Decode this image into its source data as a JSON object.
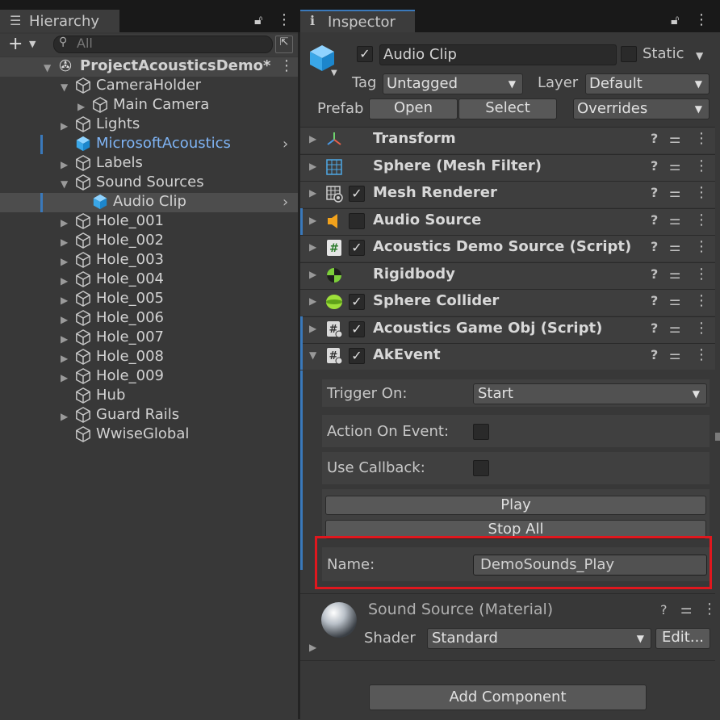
{
  "hierarchy": {
    "title": "Hierarchy",
    "search_placeholder": "All",
    "add_label": "+",
    "root": "ProjectAcousticsDemo*",
    "items": [
      {
        "label": "CameraHolder"
      },
      {
        "label": "Main Camera"
      },
      {
        "label": "Lights"
      },
      {
        "label": "MicrosoftAcoustics"
      },
      {
        "label": "Labels"
      },
      {
        "label": "Sound Sources"
      },
      {
        "label": "Audio Clip"
      },
      {
        "label": "Hole_001"
      },
      {
        "label": "Hole_002"
      },
      {
        "label": "Hole_003"
      },
      {
        "label": "Hole_004"
      },
      {
        "label": "Hole_005"
      },
      {
        "label": "Hole_006"
      },
      {
        "label": "Hole_007"
      },
      {
        "label": "Hole_008"
      },
      {
        "label": "Hole_009"
      },
      {
        "label": "Hub"
      },
      {
        "label": "Guard Rails"
      },
      {
        "label": "WwiseGlobal"
      }
    ]
  },
  "inspector": {
    "title": "Inspector",
    "object_name": "Audio Clip",
    "static_label": "Static",
    "tag_label": "Tag",
    "tag_value": "Untagged",
    "layer_label": "Layer",
    "layer_value": "Default",
    "prefab_label": "Prefab",
    "open_label": "Open",
    "select_label": "Select",
    "overrides_label": "Overrides",
    "components": [
      {
        "name": "Transform"
      },
      {
        "name": "Sphere (Mesh Filter)"
      },
      {
        "name": "Mesh Renderer"
      },
      {
        "name": "Audio Source"
      },
      {
        "name": "Acoustics Demo Source (Script)"
      },
      {
        "name": "Rigidbody"
      },
      {
        "name": "Sphere Collider"
      },
      {
        "name": "Acoustics Game Obj (Script)"
      },
      {
        "name": "AkEvent"
      }
    ],
    "akevent": {
      "trigger_label": "Trigger On:",
      "trigger_value": "Start",
      "action_label": "Action On Event:",
      "callback_label": "Use Callback:",
      "play_label": "Play",
      "stop_label": "Stop All",
      "name_label": "Name:",
      "name_value": "DemoSounds_Play"
    },
    "material": {
      "title": "Sound Source (Material)",
      "shader_label": "Shader",
      "shader_value": "Standard",
      "edit_label": "Edit..."
    },
    "add_component_label": "Add Component"
  },
  "colors": {
    "accent": "#3a79bb",
    "highlight": "#e0171e",
    "selected_text": "#7fb4f5"
  }
}
